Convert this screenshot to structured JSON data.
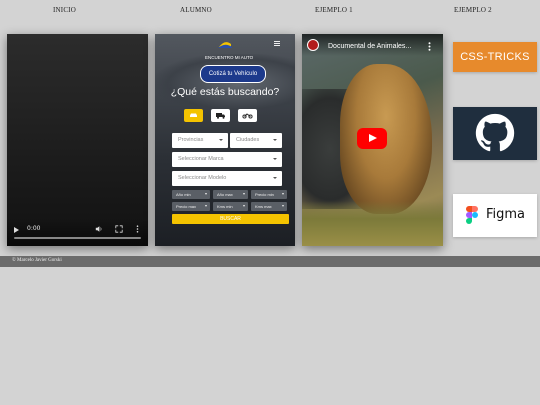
{
  "nav": {
    "items": [
      {
        "label": "INICIO"
      },
      {
        "label": "ALUMNO"
      },
      {
        "label": "EJEMPLO 1"
      },
      {
        "label": "EJEMPLO 2"
      }
    ]
  },
  "video": {
    "time": "0:00",
    "progress": 0,
    "icons": [
      "play-icon",
      "volume-icon",
      "fullscreen-icon",
      "more-options-icon"
    ]
  },
  "alumno": {
    "logo_text": "ENCUENTRO MI AUTO",
    "cotiza_label": "Cotizá tu Vehículo",
    "search_title": "¿Qué estás buscando?",
    "vehicle_types": [
      "car-icon",
      "truck-icon",
      "motorcycle-icon"
    ],
    "provincias_placeholder": "Provincias",
    "ciudades_placeholder": "Ciudades",
    "marca_placeholder": "Seleccionar Marca",
    "modelo_placeholder": "Seleccionar Modelo",
    "filters_row1": [
      "Año min",
      "Año max",
      "Precio min"
    ],
    "filters_row2": [
      "Precio max",
      "Kms min",
      "Kms max"
    ],
    "buscar_label": "BUSCAR",
    "accent": "#f4c300",
    "brand": "#1d3a8c"
  },
  "youtube": {
    "title": "Documental de Animales...",
    "play_color": "#ff0000"
  },
  "examples": {
    "css_tricks": "CSS-TRICKS",
    "figma": "Figma",
    "github_icon": "github-icon"
  },
  "footer": {
    "text": "© Marcelo Javier Gorski"
  }
}
